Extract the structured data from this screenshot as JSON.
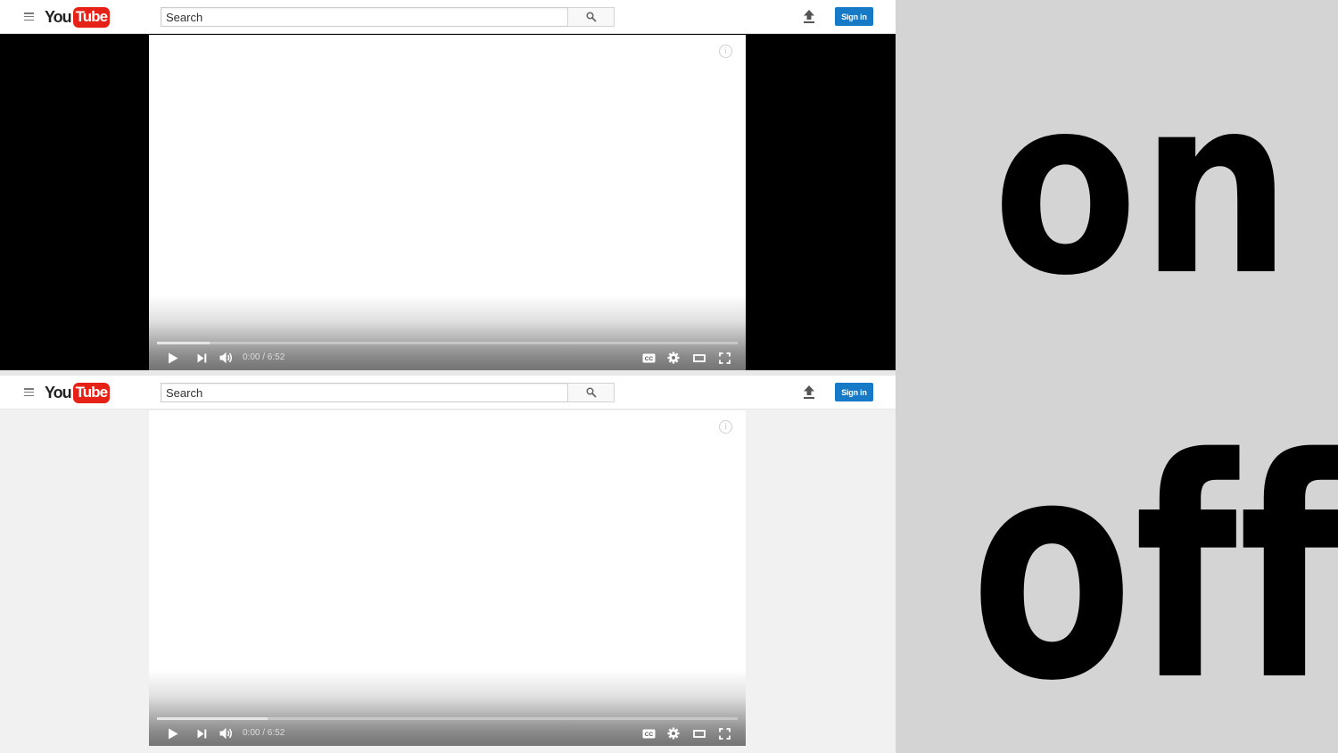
{
  "panels": [
    {
      "state": "on",
      "search_placeholder": "Search",
      "signin_label": "Sign in",
      "time_display": "0:00 / 6:52",
      "progress_loaded": 0.09
    },
    {
      "state": "off",
      "search_placeholder": "Search",
      "signin_label": "Sign in",
      "time_display": "0:00 / 6:52",
      "progress_loaded": 0.19
    }
  ],
  "logo": {
    "you": "You",
    "tube": "Tube"
  },
  "labels": {
    "on": "on",
    "off": "off"
  },
  "colors": {
    "brand_red": "#e62117",
    "signin_blue": "#167ac6",
    "on_background": "#000000",
    "off_background": "#f1f1f1"
  },
  "icons": [
    "menu-icon",
    "search-icon",
    "upload-icon",
    "info-icon",
    "play-icon",
    "next-icon",
    "volume-icon",
    "subtitles-icon",
    "settings-icon",
    "theater-icon",
    "fullscreen-icon"
  ]
}
